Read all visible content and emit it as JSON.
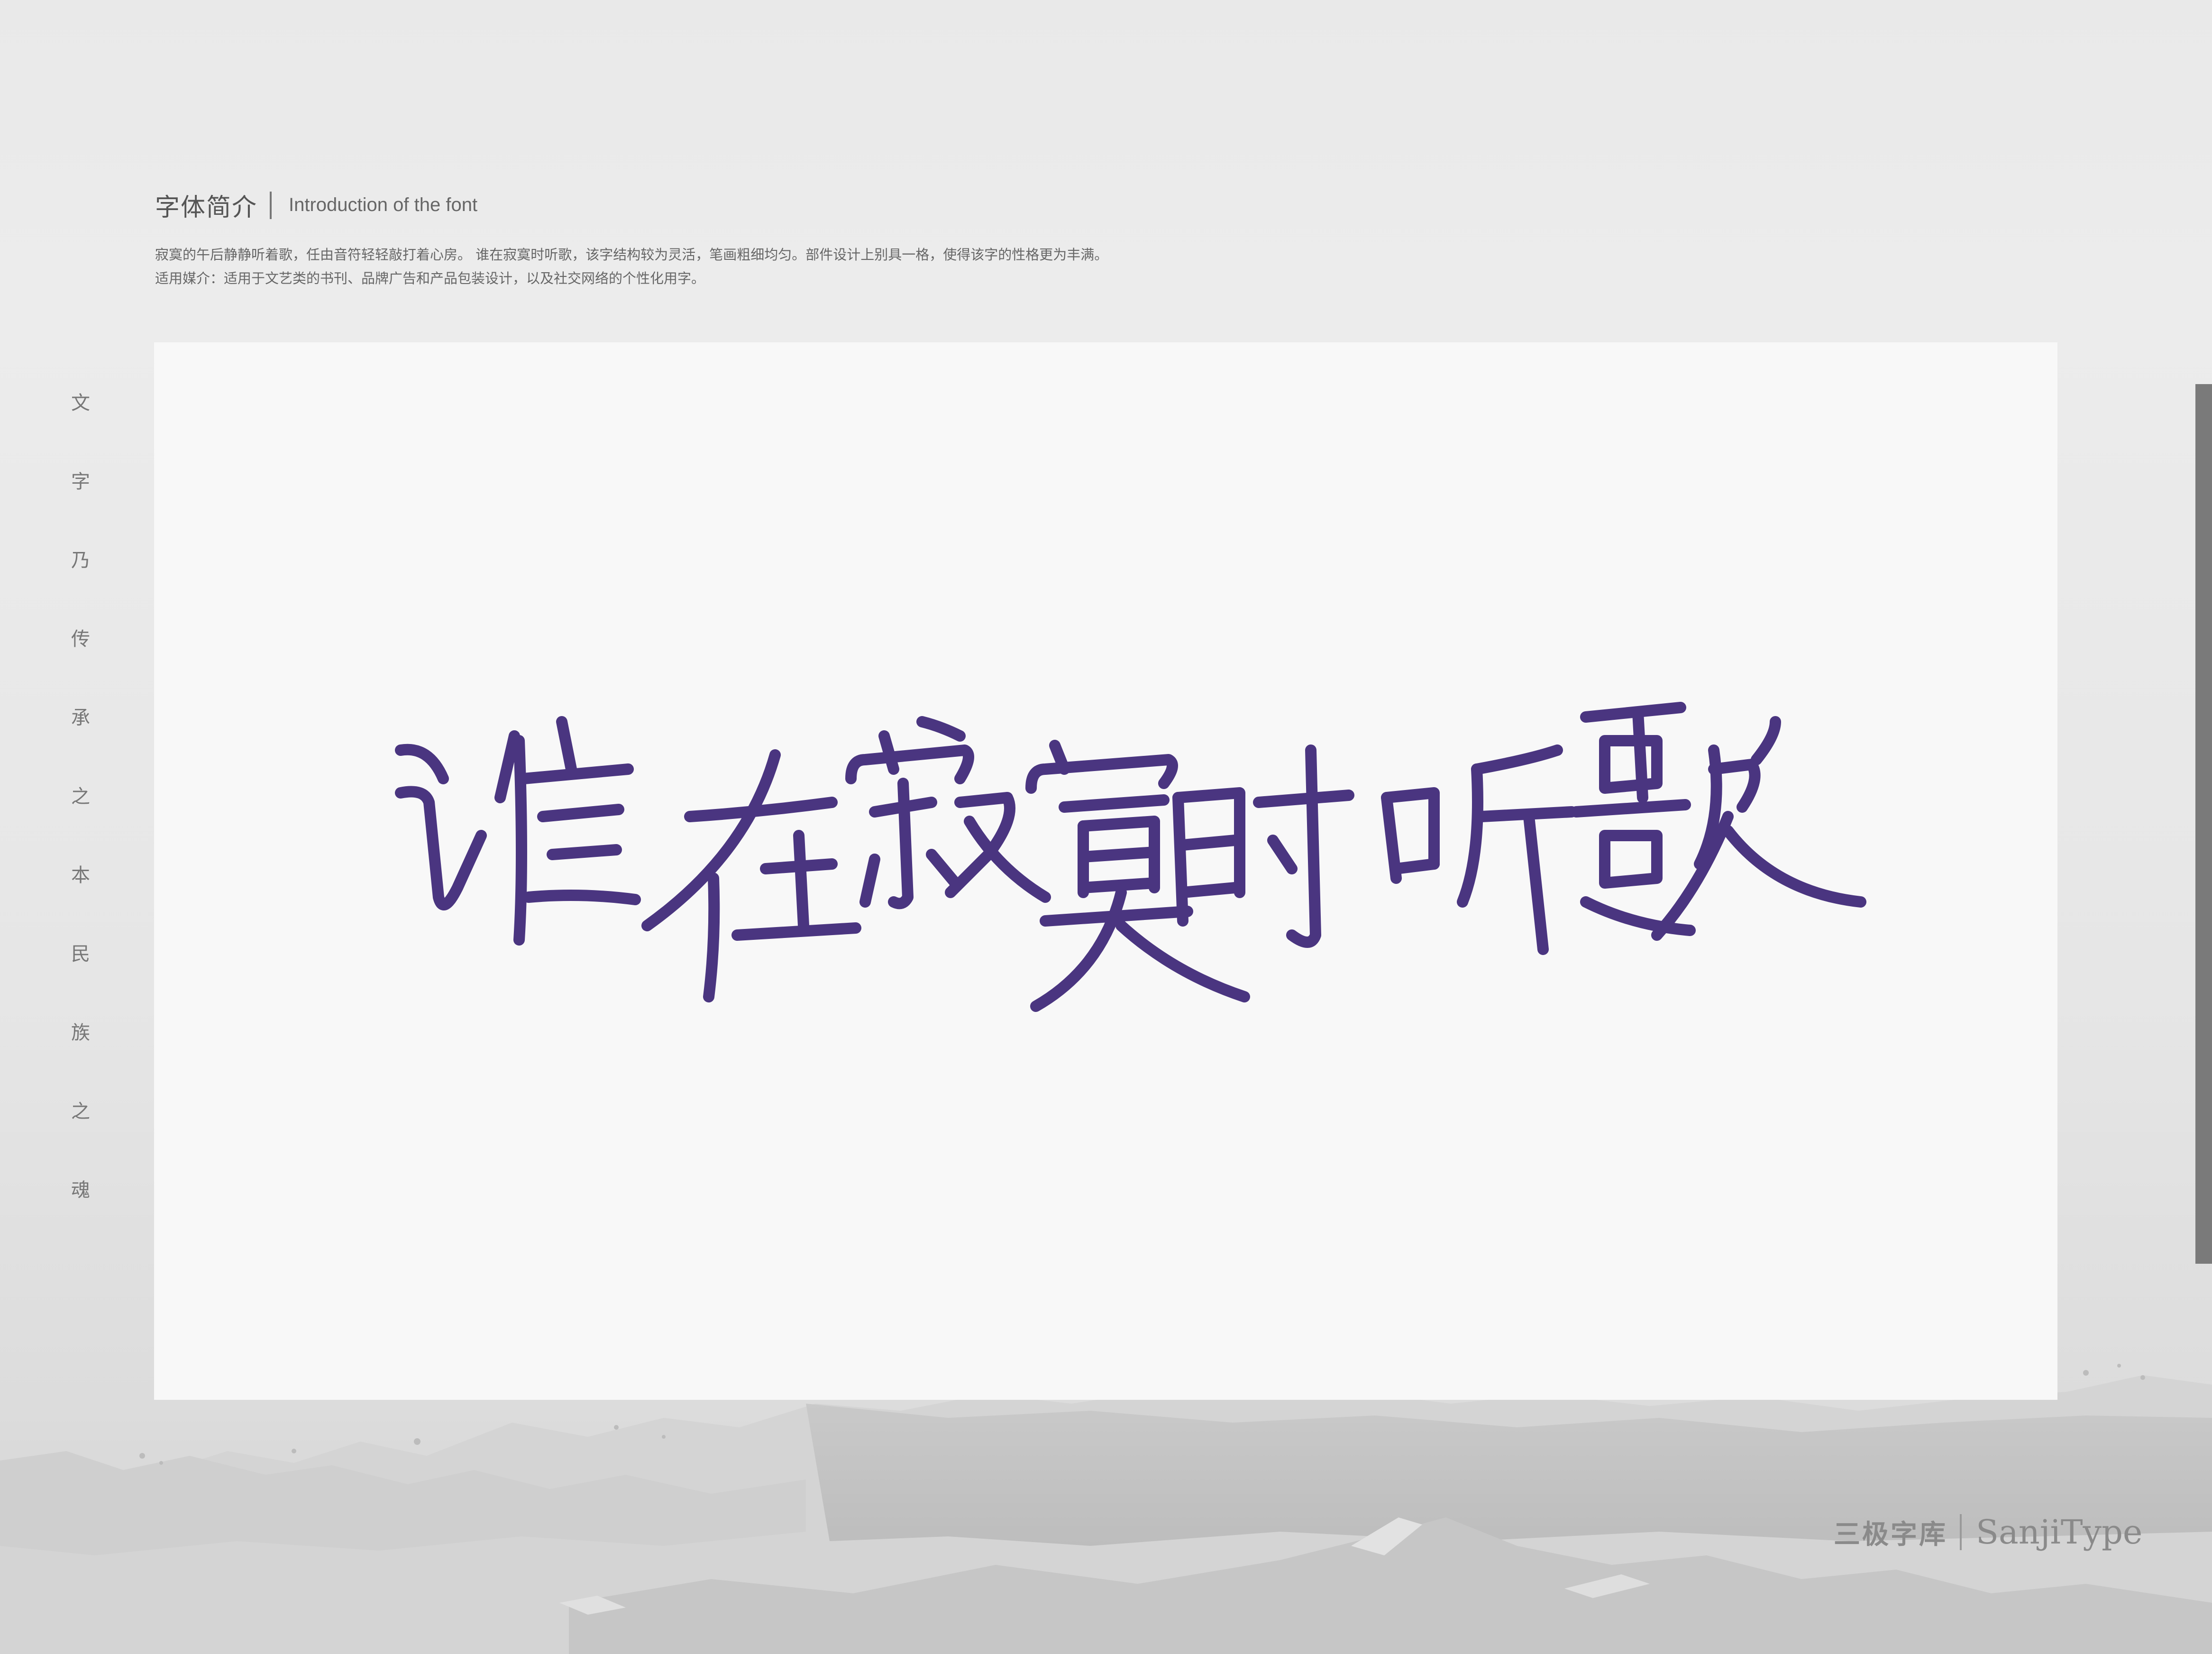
{
  "intro": {
    "title": "字体简介",
    "subtitle": "Introduction of the font",
    "desc_line1": "寂寞的午后静静听着歌，任由音符轻轻敲打着心房。 谁在寂寞时听歌，该字结构较为灵活，笔画粗细均匀。部件设计上别具一格，使得该字的性格更为丰满。",
    "desc_line2": "适用媒介：适用于文艺类的书刊、品牌广告和产品包装设计，以及社交网络的个性化用字。"
  },
  "slogan": [
    "文",
    "字",
    "乃",
    "传",
    "承",
    "之",
    "本",
    "民",
    "族",
    "之",
    "魂"
  ],
  "showcase": {
    "artwork_text": "谁在寂寞时听歌",
    "ink_color": "#4a3580"
  },
  "brand": {
    "cn": "三极字库",
    "en": "SanjiType"
  }
}
